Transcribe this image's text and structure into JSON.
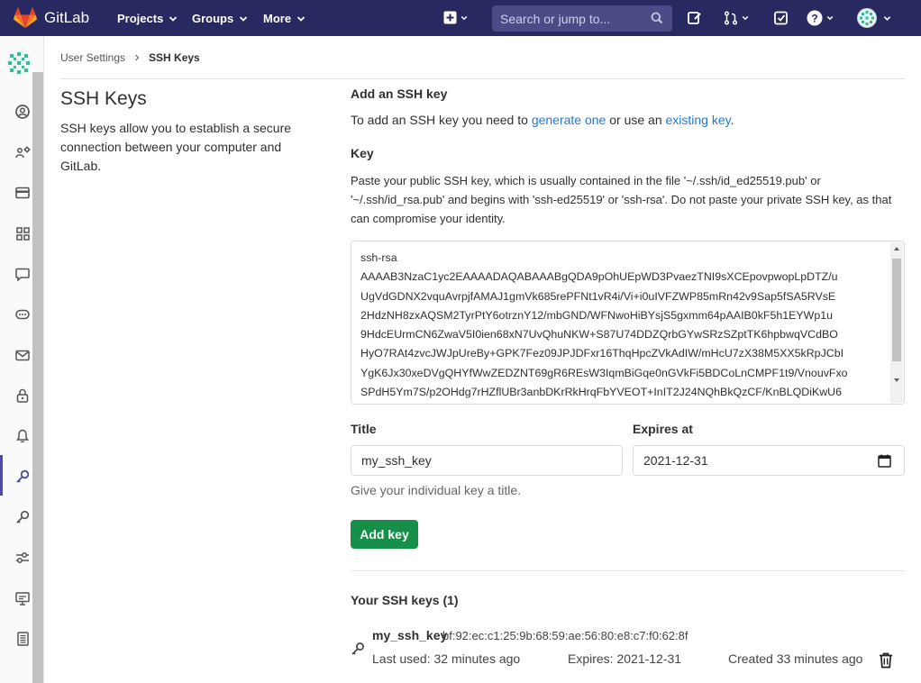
{
  "topbar": {
    "app_name": "GitLab",
    "nav": [
      {
        "label": "Projects"
      },
      {
        "label": "Groups"
      },
      {
        "label": "More"
      }
    ],
    "search_placeholder": "Search or jump to..."
  },
  "breadcrumb": {
    "parent": "User Settings",
    "current": "SSH Keys"
  },
  "left": {
    "title": "SSH Keys",
    "description": "SSH keys allow you to establish a secure connection between your computer and GitLab."
  },
  "form": {
    "heading": "Add an SSH key",
    "intro_prefix": "To add an SSH key you need to ",
    "intro_link1": "generate one",
    "intro_mid": " or use an ",
    "intro_link2": "existing key",
    "intro_suffix": ".",
    "key_label": "Key",
    "key_help": "Paste your public SSH key, which is usually contained in the file '~/.ssh/id_ed25519.pub' or '~/.ssh/id_rsa.pub' and begins with 'ssh-ed25519' or 'ssh-rsa'. Do not paste your private SSH key, as that can compromise your identity.",
    "key_lines": [
      "ssh-rsa",
      "AAAAB3NzaC1yc2EAAAADAQABAAABgQDA9pOhUEpWD3PvaezTNI9sXCEpovpwopLpDTZ/u",
      "UgVdGDNX2vquAvrpjfAMAJ1gmVk685rePFNt1vR4i/Vi+i0uIVFZWP85mRn42v9Sap5fSA5RVsE",
      "2HdzNH8zxAQSM2TyrPtY6otrznY12/mbGND/WFNwoHiBYsjS5gxmm64pAAIB0kF5h1EYWp1u",
      "9HdcEUrmCN6ZwaV5I0ien68xN7UvQhuNKW+S87U74DDZQrbGYwSRzSZptTK6hpbwqVCdBO",
      "HyO7RAt4zvcJWJpUreBy+GPK7Fez09JPJDFxr16ThqHpcZVkAdIW/mHcU7zX38M5XX5kRpJCbI",
      "YgK6Jx30xeDVgQHYfWwZEDZNT69gR6REsW3IqmBiGqe0nGVkFi5BDCoLnCMPF1t9/VnouvFxo",
      "SPdH5Ym7S/p2OHdg7rHZflUBr3anbDKrRkHrqFbYVEOT+InIT2J24NQhBkQzCF/KnBLQDiKwU6"
    ],
    "title_label": "Title",
    "title_value": "my_ssh_key",
    "expires_label": "Expires at",
    "expires_value": "2021-12-31",
    "title_hint": "Give your individual key a title.",
    "submit_label": "Add key"
  },
  "keys": {
    "heading": "Your SSH keys (1)",
    "items": [
      {
        "title": "my_ssh_key",
        "fingerprint": "bf:92:ec:c1:25:9b:68:59:ae:56:80:e8:c7:f0:62:8f",
        "last_used": "Last used: 32 minutes ago",
        "expires": "Expires: 2021-12-31",
        "created": "Created 33 minutes ago"
      }
    ]
  },
  "colors": {
    "topbar": "#292961",
    "link": "#1f78d1",
    "primary_button": "#168f48"
  }
}
